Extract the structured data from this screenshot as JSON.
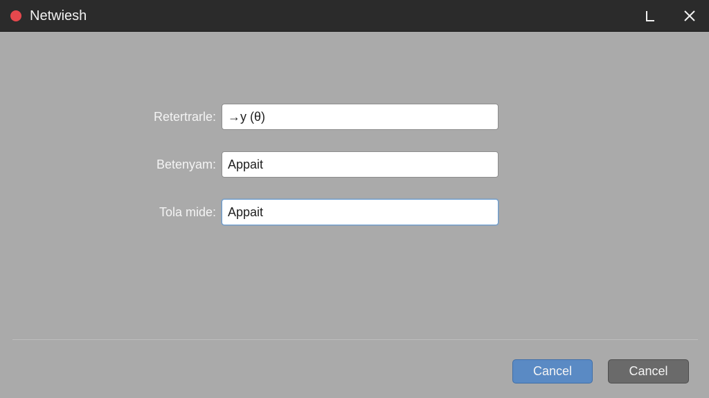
{
  "window": {
    "title": "Netwiesh",
    "status_dot_color": "#e5484d",
    "controls": {
      "minimize_label": "L",
      "close_label": "×"
    }
  },
  "form": {
    "fields": [
      {
        "label": "Retertrarle:",
        "value": "→y (θ)",
        "focused": false
      },
      {
        "label": "Betenyam:",
        "value": "Appait",
        "focused": false
      },
      {
        "label": "Tola mide:",
        "value": "Appait",
        "focused": true
      }
    ]
  },
  "footer": {
    "primary_button_label": "Cancel",
    "secondary_button_label": "Cancel",
    "primary_color": "#5a8ac4",
    "secondary_color": "#6a6a6a"
  }
}
